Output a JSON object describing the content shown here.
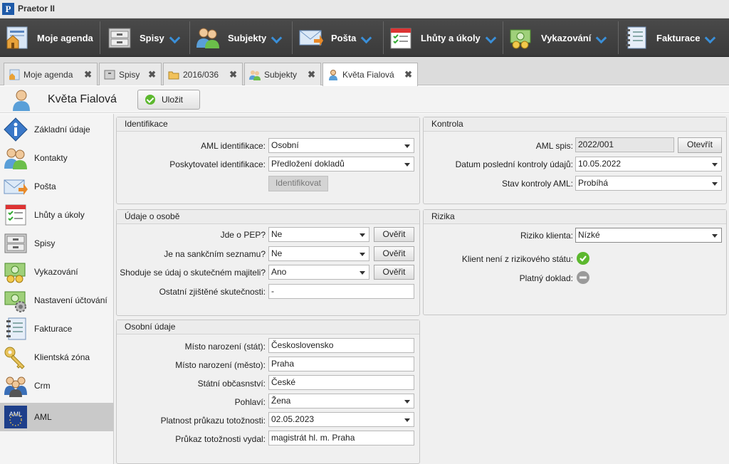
{
  "app": {
    "title": "Praetor II",
    "logo_letter": "P"
  },
  "toolbar": {
    "items": [
      {
        "label": "Moje agenda",
        "icon": "home-agenda-icon"
      },
      {
        "label": "Spisy",
        "icon": "file-cabinet-icon"
      },
      {
        "label": "Subjekty",
        "icon": "people-icon"
      },
      {
        "label": "Pošta",
        "icon": "mail-icon"
      },
      {
        "label": "Lhůty a úkoly",
        "icon": "calendar-checklist-icon"
      },
      {
        "label": "Vykazování",
        "icon": "money-coins-icon"
      },
      {
        "label": "Fakturace",
        "icon": "notebook-icon"
      }
    ]
  },
  "tabs": [
    {
      "label": "Moje agenda",
      "close": "✖"
    },
    {
      "label": "Spisy",
      "close": "✖"
    },
    {
      "label": "2016/036",
      "close": "✖"
    },
    {
      "label": "Subjekty",
      "close": "✖"
    },
    {
      "label": "Květa Fialová",
      "close": "✖"
    }
  ],
  "header": {
    "name": "Květa Fialová",
    "save_label": "Uložit"
  },
  "sidebar": {
    "items": [
      {
        "label": "Základní údaje",
        "icon": "info-icon"
      },
      {
        "label": "Kontakty",
        "icon": "contacts-icon"
      },
      {
        "label": "Pošta",
        "icon": "mail-icon"
      },
      {
        "label": "Lhůty a úkoly",
        "icon": "calendar-checklist-icon"
      },
      {
        "label": "Spisy",
        "icon": "file-cabinet-icon"
      },
      {
        "label": "Vykazování",
        "icon": "money-coins-icon"
      },
      {
        "label": "Nastavení účtování",
        "icon": "money-gear-icon"
      },
      {
        "label": "Fakturace",
        "icon": "notebook-icon"
      },
      {
        "label": "Klientská zóna",
        "icon": "key-icon"
      },
      {
        "label": "Crm",
        "icon": "people-icon"
      },
      {
        "label": "AML",
        "icon": "aml-eu-icon",
        "badge": "AML"
      }
    ]
  },
  "identifikace": {
    "title": "Identifikace",
    "aml_label": "AML identifikace:",
    "aml_value": "Osobní",
    "provider_label": "Poskytovatel identifikace:",
    "provider_value": "Předložení dokladů",
    "identify_button": "Identifikovat"
  },
  "udaje": {
    "title": "Údaje o osobě",
    "rows": [
      {
        "label": "Jde o PEP?",
        "value": "Ne",
        "button": "Ověřit"
      },
      {
        "label": "Je na sankčním seznamu?",
        "value": "Ne",
        "button": "Ověřit"
      },
      {
        "label": "Shoduje se údaj o skutečném majiteli?",
        "value": "Ano",
        "button": "Ověřit"
      }
    ],
    "other_label": "Ostatní zjištěné skutečnosti:",
    "other_value": "-"
  },
  "osobni": {
    "title": "Osobní údaje",
    "rows": [
      {
        "label": "Místo narození (stát):",
        "value": "Československo"
      },
      {
        "label": "Místo narození (město):",
        "value": "Praha"
      },
      {
        "label": "Státní občasnství:",
        "value": "České"
      },
      {
        "label": "Pohlaví:",
        "value": "Žena"
      },
      {
        "label": "Platnost průkazu totožnosti:",
        "value": "02.05.2023"
      },
      {
        "label": "Průkaz totožnosti vydal:",
        "value": "magistrát hl. m. Praha"
      }
    ]
  },
  "kontrola": {
    "title": "Kontrola",
    "spis_label": "AML spis:",
    "spis_value": "2022/001",
    "open_button": "Otevřít",
    "date_label": "Datum poslední kontroly údajů:",
    "date_value": "10.05.2022",
    "state_label": "Stav kontroly AML:",
    "state_value": "Probíhá"
  },
  "rizika": {
    "title": "Rizika",
    "risk_label": "Riziko klienta:",
    "risk_value": "Nízké",
    "state_label": "Klient není z rizikového státu:",
    "state_status": "ok",
    "doc_label": "Platný doklad:",
    "doc_status": "neutral"
  },
  "colors": {
    "toolbar_bg": "#3f3f3f",
    "accent_blue": "#3a8fd8",
    "ok_green": "#5cb82e",
    "neutral_grey": "#9a9a9a"
  }
}
